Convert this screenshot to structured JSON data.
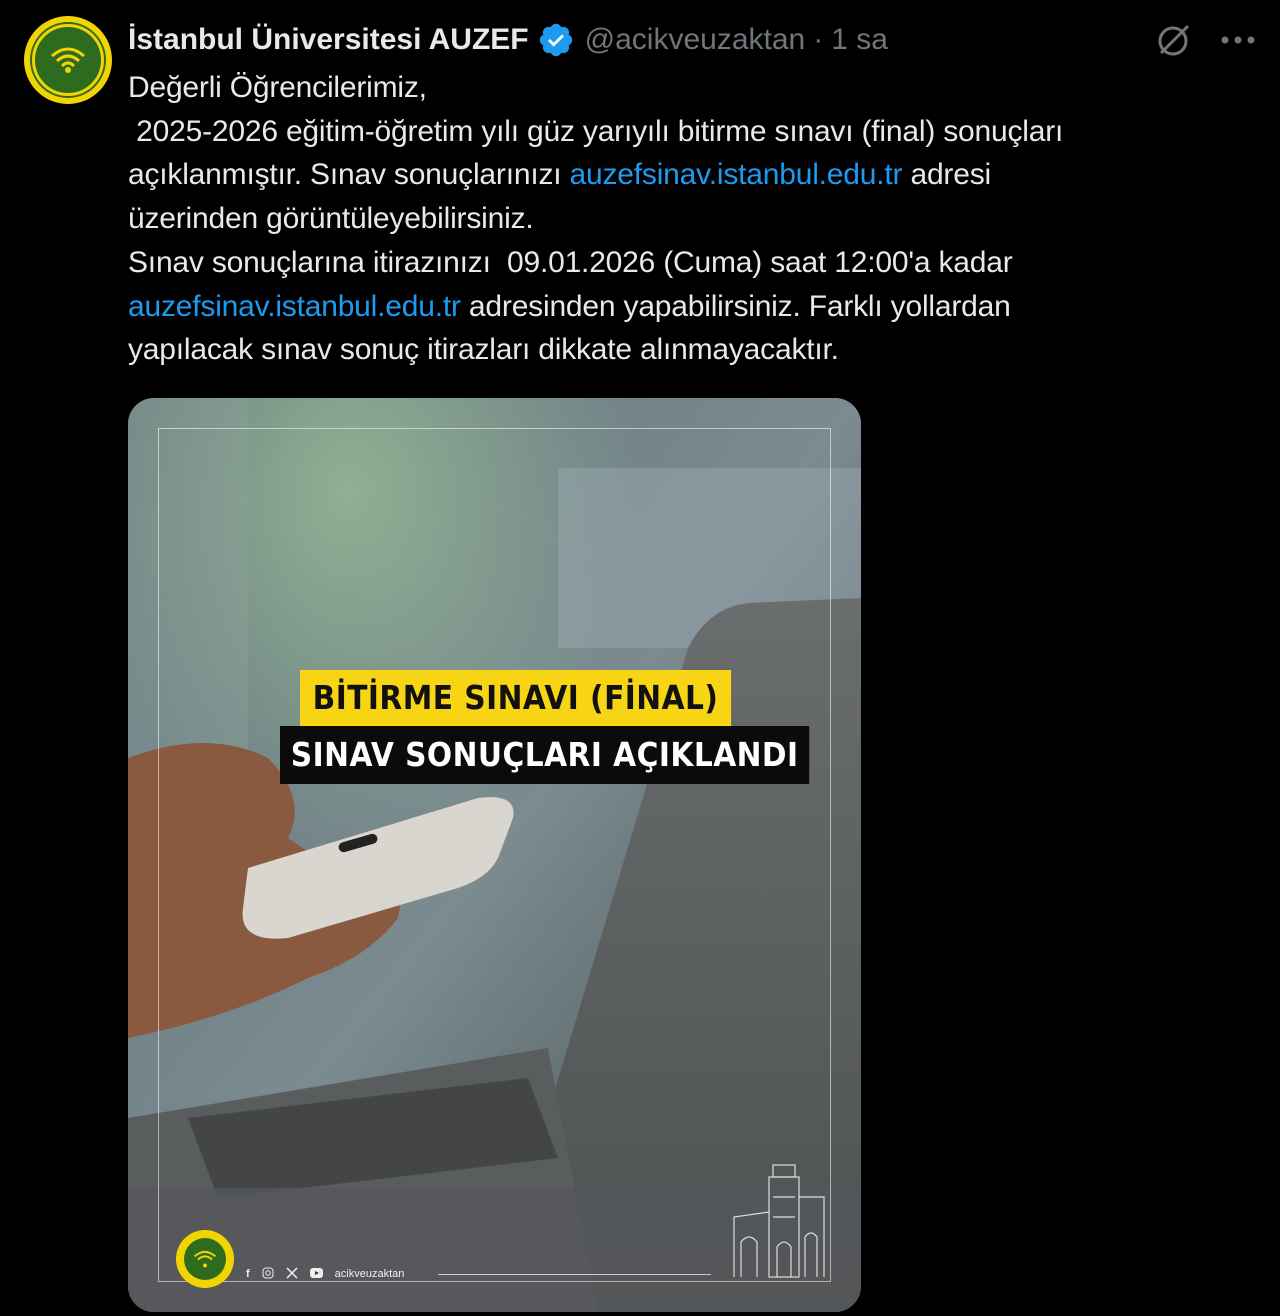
{
  "author": {
    "display_name": "İstanbul Üniversitesi AUZEF",
    "handle": "@acikveuzaktan",
    "separator": "·",
    "time": "1 sa"
  },
  "tweet": {
    "line1": "Değerli Öğrencilerimiz,",
    "line2": " 2025-2026 eğitim-öğretim yılı güz yarıyılı bitirme sınavı (final) sonuçları",
    "line3_pre": "açıklanmıştır. Sınav sonuçlarınızı ",
    "link1": "auzefsinav.istanbul.edu.tr",
    "line3_post": " adresi",
    "line4": "üzerinden görüntüleyebilirsiniz.",
    "line5": "Sınav sonuçlarına itirazınızı  09.01.2026 (Cuma) saat 12:00'a kadar",
    "link2": "auzefsinav.istanbul.edu.tr",
    "line6_post": " adresinden yapabilirsiniz. Farklı yollardan",
    "line7": "yapılacak sınav sonuç itirazları dikkate alınmayacaktır."
  },
  "media": {
    "banner_top": "BİTİRME SINAVI (FİNAL)",
    "banner_bottom": "SINAV SONUÇLARI AÇIKLANDI",
    "social_handle": "acikveuzaktan"
  },
  "colors": {
    "link": "#1d9bf0",
    "verified": "#1d9bf0",
    "banner_yellow": "#f7d414",
    "muted": "#71767b"
  },
  "icons": [
    "verified-badge-icon",
    "grok-icon",
    "more-options-icon",
    "facebook-icon",
    "instagram-icon",
    "x-icon",
    "youtube-icon"
  ]
}
